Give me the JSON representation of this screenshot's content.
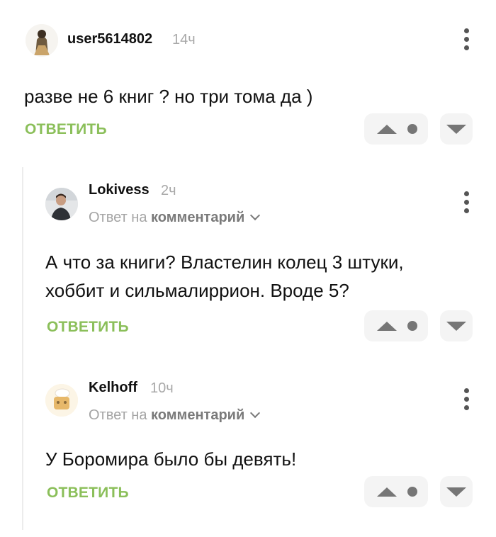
{
  "comments": [
    {
      "username": "user5614802",
      "time": "14ч",
      "text": "разве не 6 книг ? но три тома да )",
      "reply_label": "ОТВЕТИТЬ"
    },
    {
      "username": "Lokivess",
      "time": "2ч",
      "reply_to_prefix": "Ответ на",
      "reply_to_target": "комментарий",
      "text_line1": "А что за книги? Властелин колец 3 штуки,",
      "text_line2": "хоббит и сильмалиррион. Вроде 5?",
      "reply_label": "ОТВЕТИТЬ"
    },
    {
      "username": "Kelhoff",
      "time": "10ч",
      "reply_to_prefix": "Ответ на",
      "reply_to_target": "комментарий",
      "text": "У Боромира было бы девять!",
      "reply_label": "ОТВЕТИТЬ"
    }
  ],
  "icons": {
    "upvote": "triangle-up-icon",
    "rating": "dot-icon",
    "downvote": "triangle-down-icon",
    "menu": "kebab-menu-icon",
    "expand": "chevron-down-icon"
  },
  "colors": {
    "reply_button": "#8bbf5a",
    "vote_background": "#f4f4f4",
    "vote_icon": "#767676",
    "muted_text": "#a8a8a8"
  }
}
